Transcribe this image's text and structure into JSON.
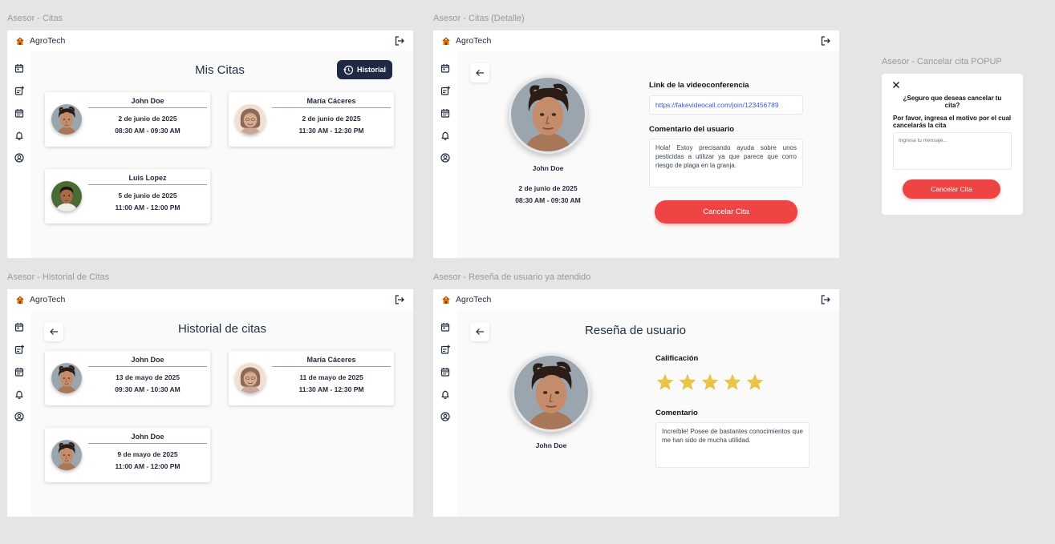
{
  "brand": "AgroTech",
  "colors": {
    "accent": "#1e2a44",
    "danger": "#ef4444",
    "star": "#e8c547",
    "link": "#3b5bdb"
  },
  "frames": {
    "citas": {
      "label": "Asesor - Citas",
      "title": "Mis Citas",
      "historial_button": "Historial",
      "cards": [
        {
          "name": "John Doe",
          "date": "2 de junio de 2025",
          "time": "08:30 AM - 09:30 AM"
        },
        {
          "name": "María Cáceres",
          "date": "2 de junio de 2025",
          "time": "11:30 AM - 12:30 PM"
        },
        {
          "name": "Luis Lopez",
          "date": "5 de junio de 2025",
          "time": "11:00 AM - 12:00 PM"
        }
      ]
    },
    "detalle": {
      "label": "Asesor - Citas (Detalle)",
      "name": "John Doe",
      "date": "2 de junio de 2025",
      "time": "08:30 AM - 09:30 AM",
      "link_label": "Link de la videoconferencia",
      "link": "https://fakevideocall.com/join/123456789",
      "comment_label": "Comentario del usuario",
      "comment": "Hola! Estoy precisando ayuda sobre unos pesticidas a utilizar ya que parece que corro riesgo de plaga en la granja.",
      "cancel_button": "Cancelar Cita"
    },
    "popup": {
      "label": "Asesor - Cancelar cita POPUP",
      "question": "¿Seguro que deseas cancelar tu cita?",
      "hint": "Por favor, ingresa el motivo por el cual cancelarás la cita",
      "placeholder": "Ingresa tu mensaje...",
      "button": "Cancelar Cita"
    },
    "historial": {
      "label": "Asesor - Historial de Citas",
      "title": "Historial de citas",
      "cards": [
        {
          "name": "John Doe",
          "date": "13 de mayo de 2025",
          "time": "09:30 AM - 10:30 AM"
        },
        {
          "name": "María Cáceres",
          "date": "11 de mayo de 2025",
          "time": "11:30 AM - 12:30 PM"
        },
        {
          "name": "John Doe",
          "date": "9 de mayo de 2025",
          "time": "11:00 AM - 12:00 PM"
        }
      ]
    },
    "resena": {
      "label": "Asesor - Reseña de usuario ya atendido",
      "title": "Reseña de usuario",
      "name": "John Doe",
      "rating_label": "Calificación",
      "rating": 5,
      "rating_max": 5,
      "comment_label": "Comentario",
      "comment": "Increíble! Posee de bastantes conocimientos que me han sido de mucha utilidad."
    }
  }
}
